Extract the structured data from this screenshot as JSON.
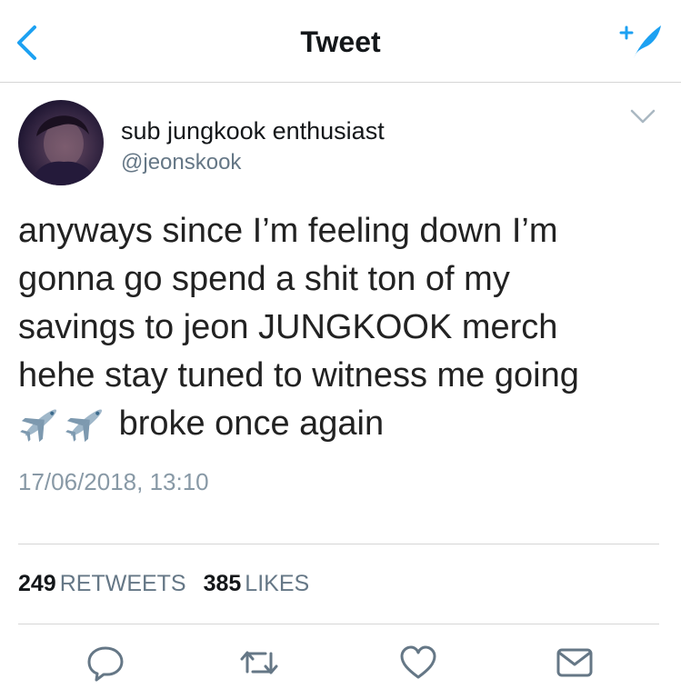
{
  "header": {
    "title": "Tweet",
    "back_icon": "chevron-left-icon",
    "compose_icon": "compose-feather-icon",
    "accent_color": "#1da1f2"
  },
  "tweet": {
    "author": {
      "name": "sub jungkook enthusiast",
      "handle": "@jeonskook"
    },
    "text_lines": [
      "anyways since I’m feeling down I’m",
      "gonna go spend a shit ton of my",
      "savings to jeon JUNGKOOK merch",
      "hehe stay tuned to witness me going",
      "broke once again"
    ],
    "emoji": [
      "airplane-emoji",
      "airplane-emoji"
    ],
    "timestamp": "17/06/2018, 13:10"
  },
  "stats": {
    "retweets_count": "249",
    "retweets_label": "RETWEETS",
    "likes_count": "385",
    "likes_label": "LIKES"
  },
  "actions": [
    "reply-icon",
    "retweet-icon",
    "like-icon",
    "message-icon"
  ]
}
